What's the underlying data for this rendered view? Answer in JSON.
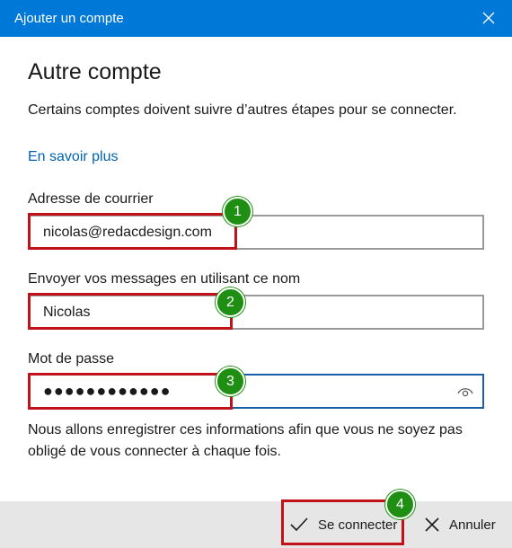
{
  "window": {
    "title": "Ajouter un compte"
  },
  "heading": "Autre compte",
  "description": "Certains comptes doivent suivre d’autres étapes pour se connecter.",
  "learn_more": "En savoir plus",
  "email": {
    "label": "Adresse de courrier",
    "value": "nicolas@redacdesign.com"
  },
  "name": {
    "label": "Envoyer vos messages en utilisant ce nom",
    "value": "Nicolas"
  },
  "password": {
    "label": "Mot de passe",
    "value": "●●●●●●●●●●●●"
  },
  "note": "Nous allons enregistrer ces informations afin que vous ne soyez pas obligé de vous connecter à chaque fois.",
  "buttons": {
    "connect": "Se connecter",
    "cancel": "Annuler"
  },
  "badges": [
    "1",
    "2",
    "3",
    "4"
  ],
  "colors": {
    "accent": "#0078d7",
    "highlight": "#c1121c",
    "badge": "#1f8f13",
    "link": "#0063b1"
  },
  "icons": {
    "close": "close-icon",
    "eye": "eye-icon",
    "check": "checkmark-icon",
    "cancel": "x-icon"
  }
}
